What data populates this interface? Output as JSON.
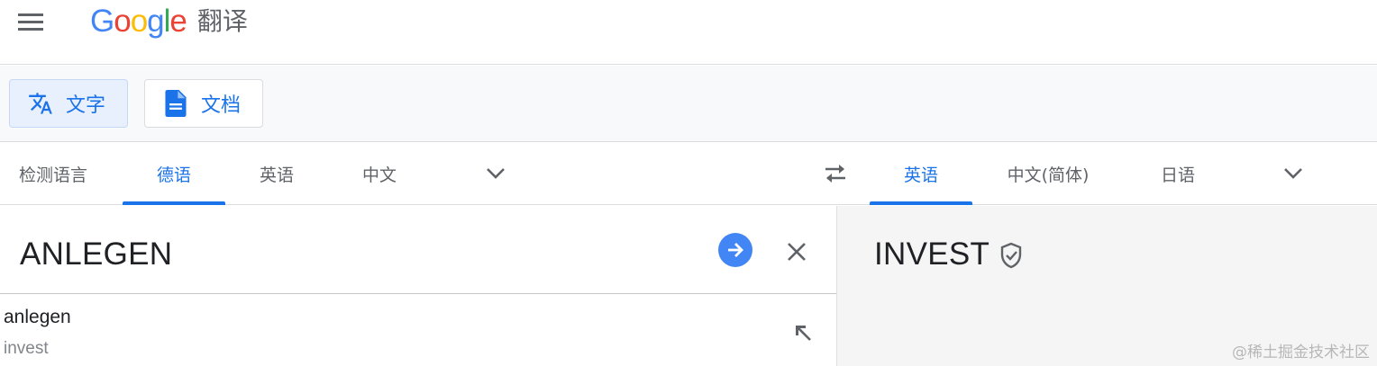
{
  "header": {
    "logo": {
      "letters": [
        {
          "char": "G",
          "color": "#4285f4"
        },
        {
          "char": "o",
          "color": "#ea4335"
        },
        {
          "char": "o",
          "color": "#fbbc05"
        },
        {
          "char": "g",
          "color": "#4285f4"
        },
        {
          "char": "l",
          "color": "#34a853"
        },
        {
          "char": "e",
          "color": "#ea4335"
        }
      ],
      "product": "翻译"
    },
    "menu_icon": "hamburger-menu-icon"
  },
  "modes": [
    {
      "label": "文字",
      "icon": "translate-icon",
      "active": true
    },
    {
      "label": "文档",
      "icon": "document-icon",
      "active": false
    }
  ],
  "source_languages": [
    {
      "label": "检测语言",
      "active": false
    },
    {
      "label": "德语",
      "active": true
    },
    {
      "label": "英语",
      "active": false
    },
    {
      "label": "中文",
      "active": false
    }
  ],
  "target_languages": [
    {
      "label": "英语",
      "active": true
    },
    {
      "label": "中文(简体)",
      "active": false
    },
    {
      "label": "日语",
      "active": false
    }
  ],
  "source": {
    "text": "ANLEGEN",
    "suggestion": {
      "word": "anlegen",
      "translation": "invest"
    }
  },
  "target": {
    "text": "INVEST"
  },
  "watermark": "@稀土掘金技术社区",
  "colors": {
    "accent": "#1a73e8",
    "go_button": "#4285f4",
    "target_bg": "#f5f5f5"
  }
}
